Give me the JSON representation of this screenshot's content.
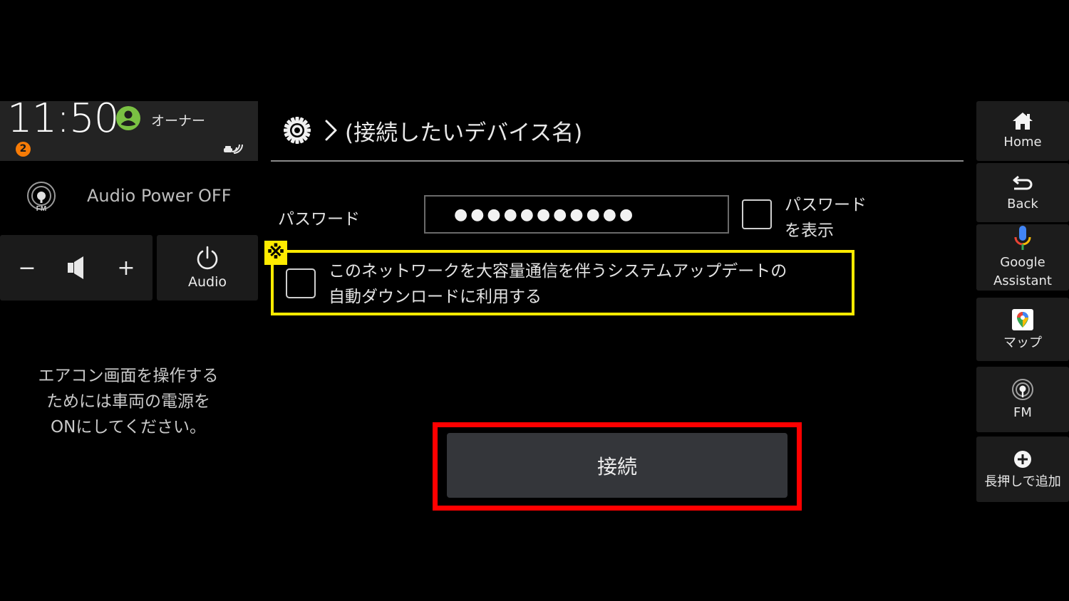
{
  "status": {
    "time": "11:50",
    "notification_count": "2",
    "user_name": "オーナー",
    "user_icon_color": "#7ac143",
    "badge_color": "#f77b06"
  },
  "audio": {
    "source_icon": "fm-radio-icon",
    "source_icon_label": "FM",
    "status_text": "Audio Power OFF",
    "volume_down_label": "−",
    "volume_up_label": "+",
    "power_button_label": "Audio"
  },
  "climate": {
    "message": "エアコン画面を操作する\nためには車両の電源を\nONにしてください。"
  },
  "header": {
    "settings_icon": "gear-icon",
    "separator": "›",
    "title": "(接続したいデバイス名)"
  },
  "form": {
    "password_label": "パスワード",
    "password_value": "●●●●●●●●●●●",
    "show_password_label": "パスワード\nを表示",
    "show_password_checked": false,
    "auto_download_label": "このネットワークを大容量通信を伴うシステムアップデートの\n自動ダウンロードに利用する",
    "auto_download_checked": false,
    "note_mark": "※",
    "connect_button_label": "接続"
  },
  "annotations": {
    "highlight_yellow": "#ffeb00",
    "highlight_red": "#ff0000"
  },
  "rail": {
    "items": [
      {
        "icon": "home-icon",
        "label": "Home"
      },
      {
        "icon": "back-icon",
        "label": "Back"
      },
      {
        "icon": "microphone-icon",
        "label": "Google\nAssistant"
      },
      {
        "icon": "map-pin-icon",
        "label": "マップ"
      },
      {
        "icon": "fm-radio-icon",
        "label": "FM"
      },
      {
        "icon": "add-circle-icon",
        "label": "長押しで追加"
      }
    ]
  }
}
